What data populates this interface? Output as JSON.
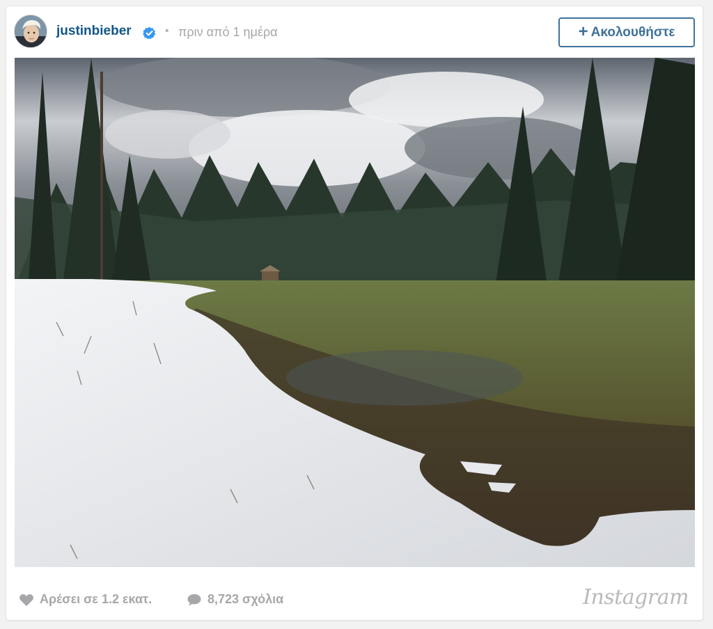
{
  "post": {
    "username": "justinbieber",
    "verified": true,
    "separator": "•",
    "time_ago": "πριν από 1 ημέρα",
    "follow_label": "Ακολουθήστε",
    "follow_icon": "plus-icon"
  },
  "stats": {
    "likes_label": "Αρέσει σε 1.2 εκατ.",
    "comments_label": "8,723 σχόλια"
  },
  "brand": {
    "logo_text": "Instagram"
  },
  "colors": {
    "link": "#125688",
    "follow_border": "#3f729b",
    "verified_badge": "#3897f0",
    "muted": "#a5a7aa"
  }
}
